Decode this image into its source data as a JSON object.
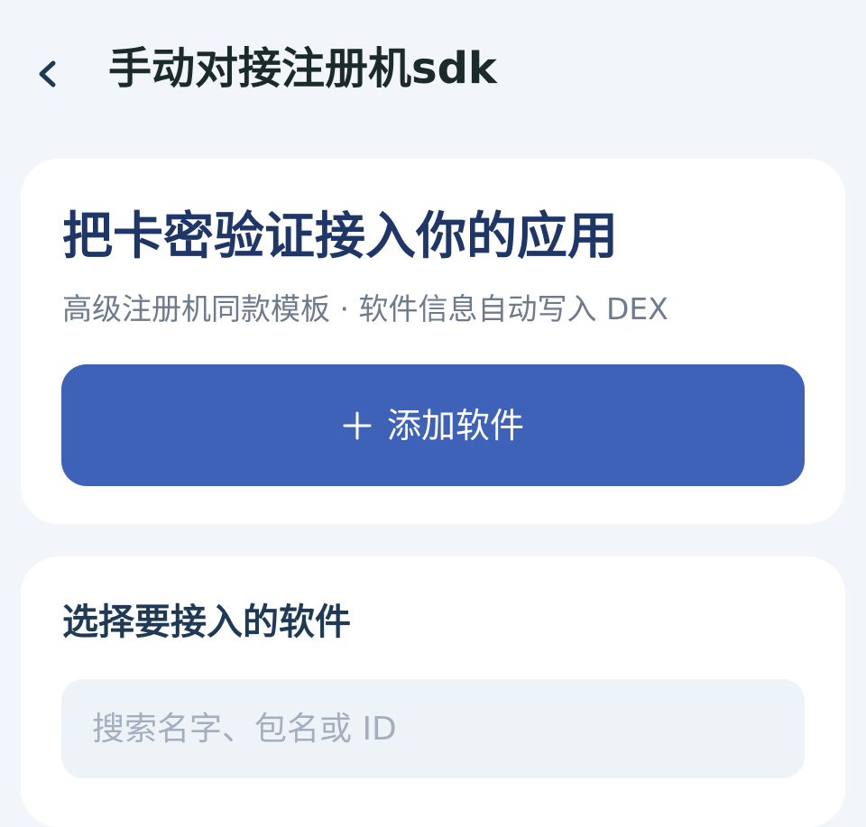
{
  "header": {
    "back_icon": "chevron-left-icon",
    "title": "手动对接注册机sdk"
  },
  "hero_card": {
    "title": "把卡密验证接入你的应用",
    "subtitle": "高级注册机同款模板 · 软件信息自动写入 DEX",
    "add_button": {
      "icon": "plus-icon",
      "label": "添加软件"
    }
  },
  "select_card": {
    "title": "选择要接入的软件",
    "search": {
      "placeholder": "搜索名字、包名或 ID",
      "value": ""
    }
  },
  "colors": {
    "background": "#f2f6fa",
    "card": "#ffffff",
    "primary_button": "#3d62b8",
    "hero_title": "#1e3768",
    "subtitle": "#6d7b8d",
    "search_bg": "#eef3f8"
  }
}
